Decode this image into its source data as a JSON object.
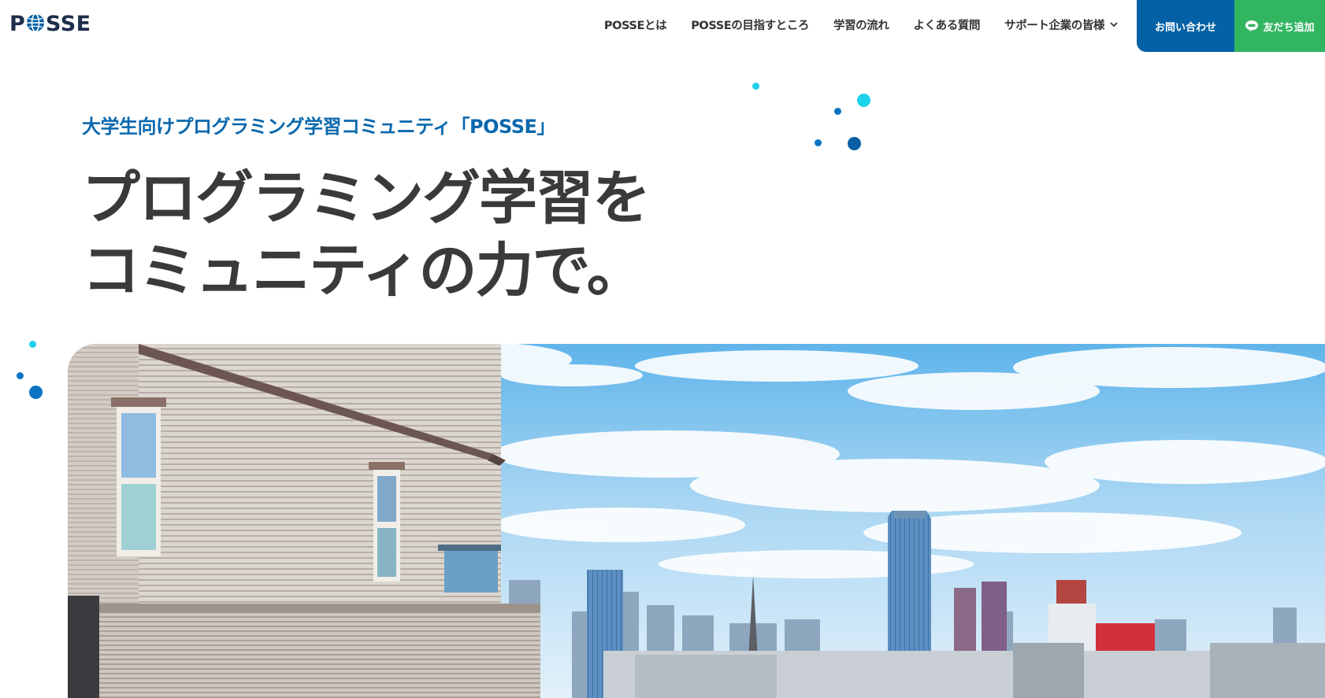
{
  "brand": {
    "logo_text": "POSSE",
    "logo_icon": "globe-o-icon",
    "colors": {
      "primary": "#0561a5",
      "line": "#32b561",
      "text": "#333333",
      "accent_cyan": "#1ed2ec"
    }
  },
  "nav": {
    "items": [
      {
        "label": "POSSEとは"
      },
      {
        "label": "POSSEの目指すところ"
      },
      {
        "label": "学習の流れ"
      },
      {
        "label": "よくある質問"
      },
      {
        "label": "サポート企業の皆様",
        "icon": "chevron-down-icon"
      }
    ],
    "contact_label": "お問い合わせ",
    "line_label": "友だち追加",
    "line_icon": "line-chat-icon"
  },
  "hero": {
    "subtitle": "大学生向けプログラミング学習コミュニティ「POSSE」",
    "title_line1": "プログラミング学習を",
    "title_line2": "コミュニティの力で。",
    "image": "city-rooftop-photo"
  }
}
